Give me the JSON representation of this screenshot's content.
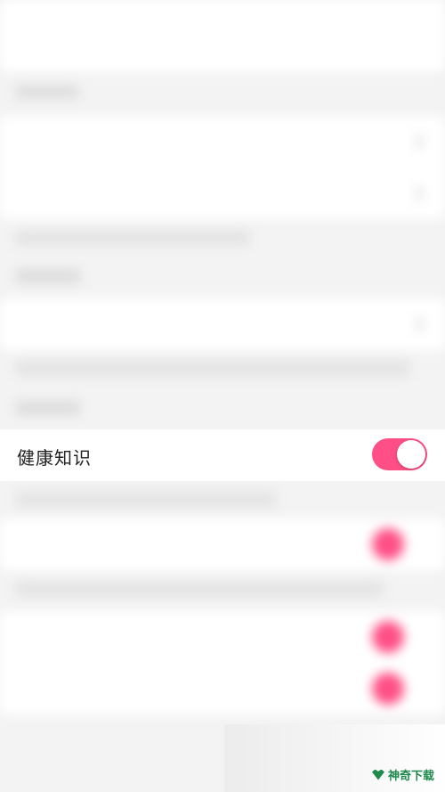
{
  "highlighted_row": {
    "label": "健康知识",
    "toggle_on": true
  },
  "watermark": {
    "text": "神奇下载"
  },
  "colors": {
    "accent": "#ff4f86",
    "background": "#f3f3f3",
    "row": "#ffffff"
  },
  "icons": {
    "watermark": "leaf-logo-icon"
  }
}
